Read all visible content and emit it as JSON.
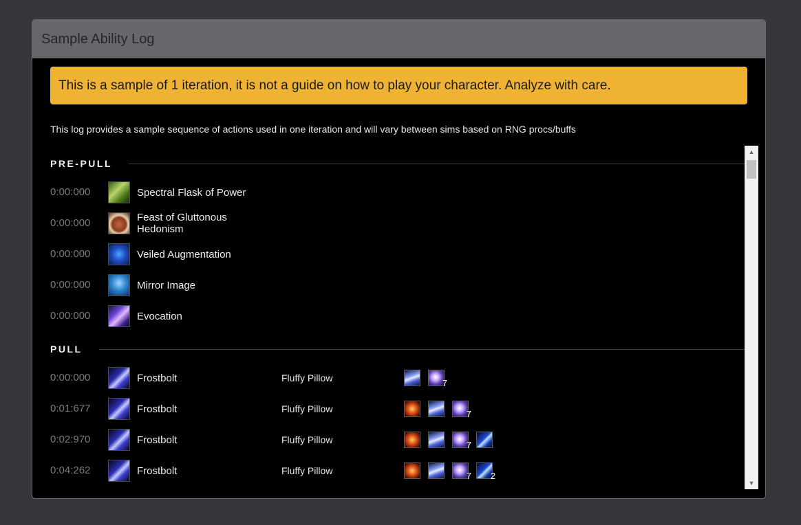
{
  "panel": {
    "title": "Sample Ability Log"
  },
  "warning": "This is a sample of 1 iteration, it is not a guide on how to play your character. Analyze with care.",
  "description": "This log provides a sample sequence of actions used in one iteration and will vary between sims based on RNG procs/buffs",
  "sections": {
    "prepull": {
      "label": "PRE-PULL",
      "rows": [
        {
          "time": "0:00:000",
          "ability": "Spectral Flask of Power",
          "icon": "spectral-flask-icon"
        },
        {
          "time": "0:00:000",
          "ability": "Feast of Gluttonous Hedonism",
          "icon": "feast-icon"
        },
        {
          "time": "0:00:000",
          "ability": "Veiled Augmentation",
          "icon": "veiled-augment-rune-icon"
        },
        {
          "time": "0:00:000",
          "ability": "Mirror Image",
          "icon": "mirror-image-icon"
        },
        {
          "time": "0:00:000",
          "ability": "Evocation",
          "icon": "evocation-icon"
        }
      ]
    },
    "pull": {
      "label": "PULL",
      "rows": [
        {
          "time": "0:00:000",
          "ability": "Frostbolt",
          "target": "Fluffy Pillow",
          "icon": "frostbolt-icon",
          "buffs": [
            {
              "icon": "frost-swirl-buff-icon",
              "stack": ""
            },
            {
              "icon": "arcane-orb-buff-icon",
              "stack": "7"
            }
          ]
        },
        {
          "time": "0:01:677",
          "ability": "Frostbolt",
          "target": "Fluffy Pillow",
          "icon": "frostbolt-icon",
          "buffs": [
            {
              "icon": "fire-buff-icon",
              "stack": ""
            },
            {
              "icon": "frost-swirl-buff-icon",
              "stack": ""
            },
            {
              "icon": "arcane-orb-buff-icon",
              "stack": "7"
            }
          ]
        },
        {
          "time": "0:02:970",
          "ability": "Frostbolt",
          "target": "Fluffy Pillow",
          "icon": "frostbolt-icon",
          "buffs": [
            {
              "icon": "fire-buff-icon",
              "stack": ""
            },
            {
              "icon": "frost-swirl-buff-icon",
              "stack": ""
            },
            {
              "icon": "arcane-orb-buff-icon",
              "stack": "7"
            },
            {
              "icon": "icy-bolt-buff-icon",
              "stack": ""
            }
          ]
        },
        {
          "time": "0:04:262",
          "ability": "Frostbolt",
          "target": "Fluffy Pillow",
          "icon": "frostbolt-icon",
          "buffs": [
            {
              "icon": "fire-buff-icon",
              "stack": ""
            },
            {
              "icon": "frost-swirl-buff-icon",
              "stack": ""
            },
            {
              "icon": "arcane-orb-buff-icon",
              "stack": "7"
            },
            {
              "icon": "icy-bolt-buff-icon",
              "stack": "2"
            }
          ]
        }
      ]
    }
  },
  "scrollbar": {
    "up_glyph": "▲",
    "down_glyph": "▼"
  }
}
